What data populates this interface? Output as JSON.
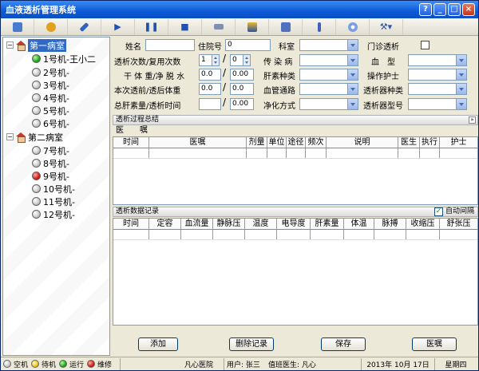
{
  "window": {
    "title": "血液透析管理系统"
  },
  "tree": {
    "wards": [
      {
        "label": "第一病室",
        "selected": true,
        "machines": [
          {
            "label": "1号机-王小二",
            "status": "green"
          },
          {
            "label": "2号机-",
            "status": "gray"
          },
          {
            "label": "3号机-",
            "status": "gray"
          },
          {
            "label": "4号机-",
            "status": "gray"
          },
          {
            "label": "5号机-",
            "status": "gray"
          },
          {
            "label": "6号机-",
            "status": "gray"
          }
        ]
      },
      {
        "label": "第二病室",
        "selected": false,
        "machines": [
          {
            "label": "7号机-",
            "status": "gray"
          },
          {
            "label": "8号机-",
            "status": "gray"
          },
          {
            "label": "9号机-",
            "status": "red"
          },
          {
            "label": "10号机-",
            "status": "gray"
          },
          {
            "label": "11号机-",
            "status": "gray"
          },
          {
            "label": "12号机-",
            "status": "gray"
          }
        ]
      }
    ]
  },
  "form": {
    "name_label": "姓名",
    "inpatient_label": "住院号",
    "inpatient_value": "0",
    "dept_label": "科室",
    "outpatient_label": "门诊透析",
    "count_label": "透析次数/复用次数",
    "count_value": "1",
    "reuse_value": "0",
    "infection_label": "传 染 病",
    "blood_label": "血　型",
    "weight_label": "干 体 重/净 脱 水",
    "dry_weight": "0.0",
    "net_dehydration": "0.00",
    "heparin_type_label": "肝素种类",
    "nurse_label": "操作护士",
    "before_after_label": "本次透前/透后体重",
    "before_weight": "0.0",
    "after_weight": "0.0",
    "vascular_label": "血管通路",
    "dialyzer_type_label": "透析器种类",
    "heparin_total_label": "总肝素量/透析时间",
    "dialysis_time": "0.00",
    "purify_label": "净化方式",
    "dialyzer_model_label": "透析器型号"
  },
  "summary": {
    "title": "透析过程总结",
    "orders_label": "医　　嘱"
  },
  "orders_grid": {
    "columns": [
      "时间",
      "医嘱",
      "剂量",
      "单位",
      "途径",
      "频次",
      "说明",
      "医生",
      "执行",
      "护士"
    ]
  },
  "records": {
    "title": "透析数据记录",
    "auto_interval_label": "自动间隔",
    "columns": [
      "时间",
      "定容",
      "血流量",
      "静脉压",
      "温度",
      "电导度",
      "肝素量",
      "体温",
      "脉搏",
      "收缩压",
      "舒张压"
    ]
  },
  "buttons": {
    "add": "添加",
    "delete": "删除记录",
    "save": "保存",
    "orders": "医嘱"
  },
  "status": {
    "legend": [
      {
        "label": "空机",
        "color": "gray"
      },
      {
        "label": "待机",
        "color": "yellow"
      },
      {
        "label": "运行",
        "color": "green"
      },
      {
        "label": "维修",
        "color": "red"
      }
    ],
    "hospital": "凡心医院",
    "user": "用户: 张三",
    "doctor": "值班医生: 凡心",
    "date": "2013年 10月 17日",
    "weekday": "星期四"
  }
}
